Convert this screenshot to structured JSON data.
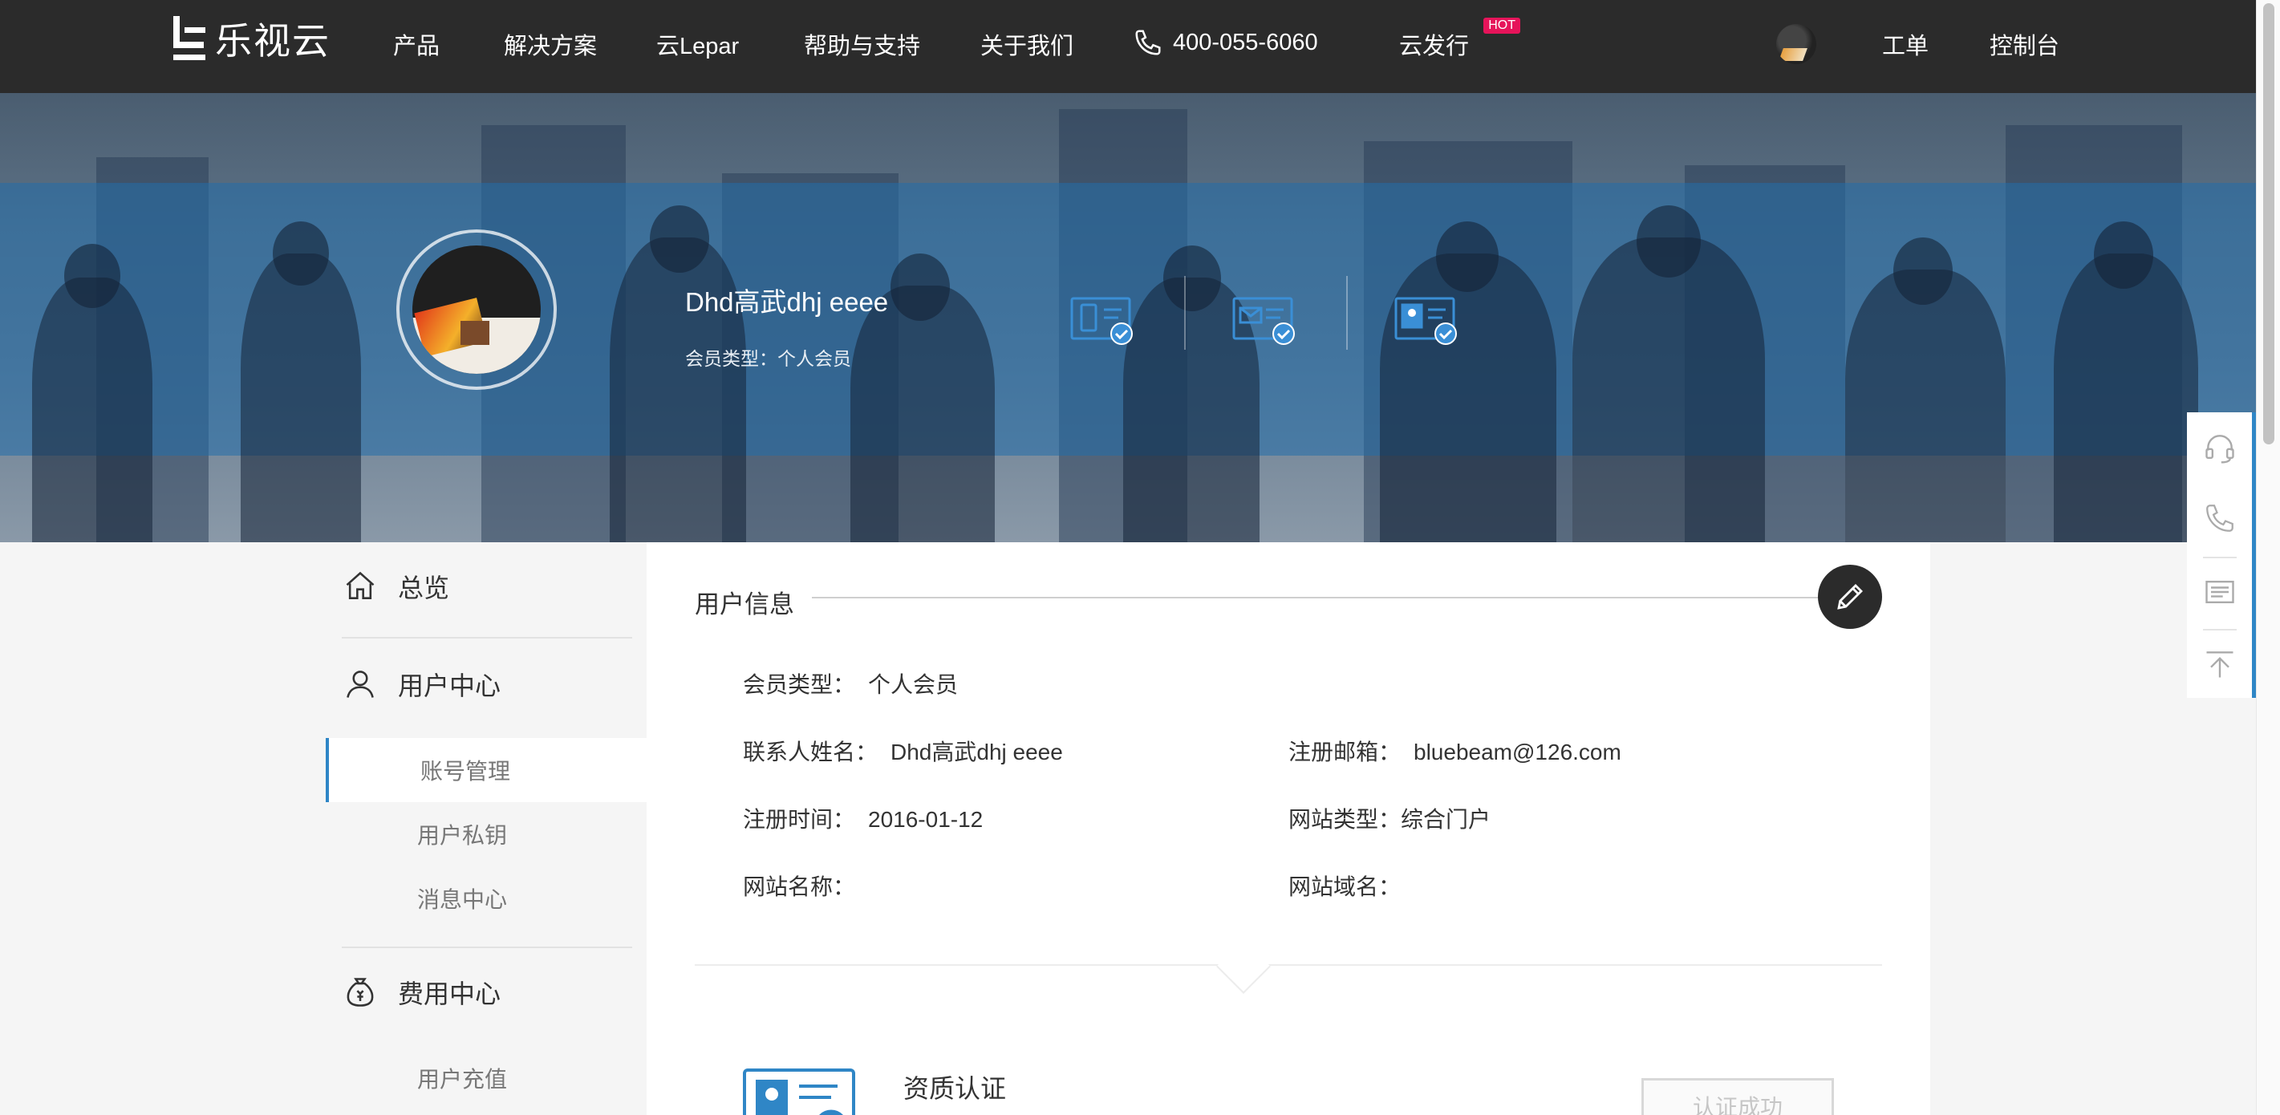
{
  "nav": {
    "logo_text": "乐视云",
    "items": [
      "产品",
      "解决方案",
      "云Lepar",
      "帮助与支持",
      "关于我们"
    ],
    "phone": "400-055-6060",
    "cloud_publish": "云发行",
    "hot_badge": "HOT",
    "ticket": "工单",
    "console": "控制台"
  },
  "banner": {
    "username": "Dhd高武dhj eeee",
    "member_type": "会员类型：个人会员"
  },
  "sidebar": {
    "overview": "总览",
    "user_center": "用户中心",
    "user_items": [
      "账号管理",
      "用户私钥",
      "消息中心"
    ],
    "billing_center": "费用中心",
    "billing_items": [
      "用户充值"
    ]
  },
  "main": {
    "section_title": "用户信息",
    "member_type_label": "会员类型：",
    "member_type_value": "个人会员",
    "contact_name_label": "联系人姓名：",
    "contact_name_value": "Dhd高武dhj eeee",
    "email_label": "注册邮箱：",
    "email_value": "bluebeam@126.com",
    "reg_time_label": "注册时间：",
    "reg_time_value": "2016-01-12",
    "site_type_label": "网站类型：",
    "site_type_value": "综合门户",
    "site_name_label": "网站名称：",
    "site_name_value": "",
    "domain_label": "网站域名：",
    "domain_value": "",
    "cert_title": "资质认证",
    "cert_button": "认证成功"
  },
  "colors": {
    "nav_bg": "#2b2b2b",
    "accent": "#2f86c6",
    "hot": "#e6145a"
  },
  "icons": {
    "float": [
      "headset-icon",
      "phone-icon",
      "message-icon",
      "back-to-top-icon"
    ],
    "verify": [
      "phone-verified-icon",
      "email-verified-icon",
      "id-verified-icon"
    ]
  }
}
